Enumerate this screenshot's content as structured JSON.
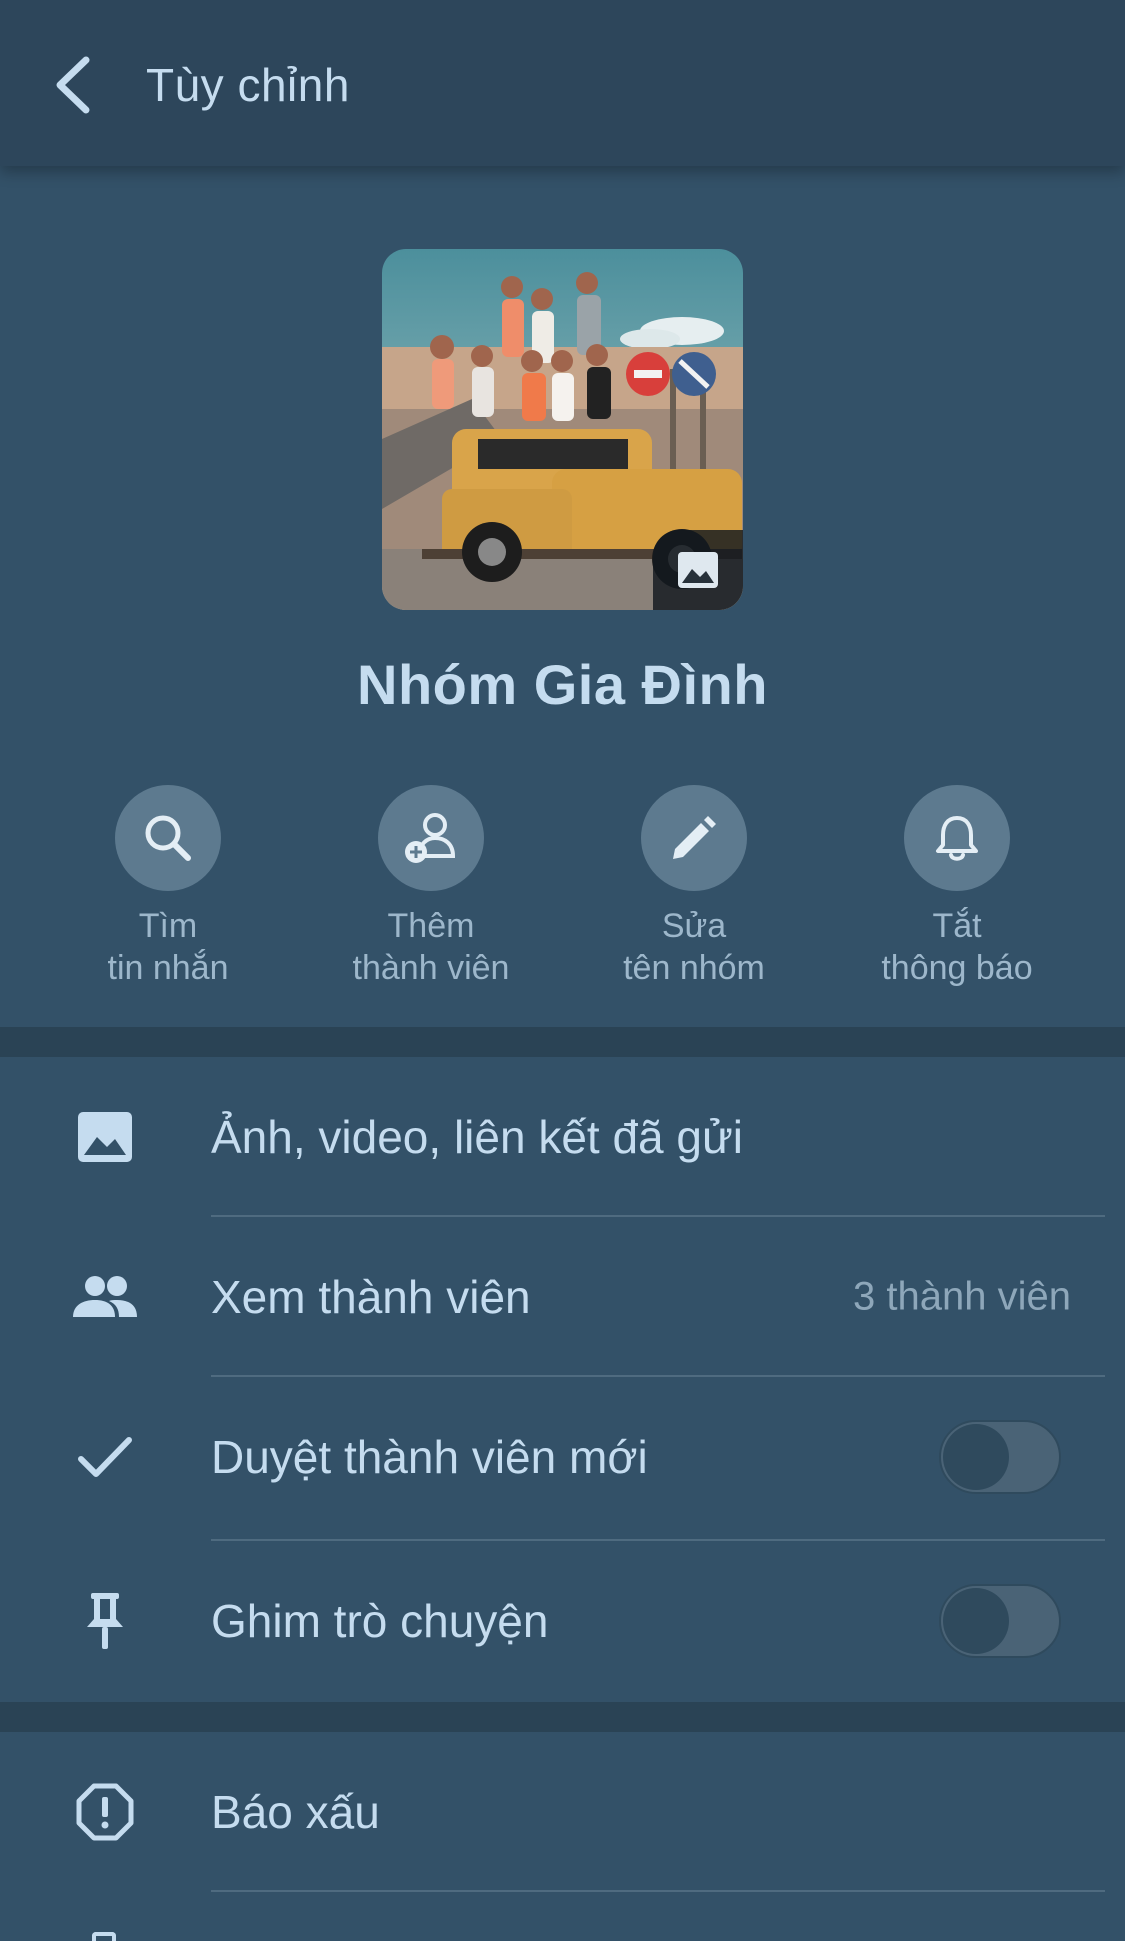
{
  "header": {
    "title": "Tùy chỉnh",
    "back_icon": "chevron-left-icon"
  },
  "group": {
    "name": "Nhóm Gia Đình",
    "avatar_icon": "group-photo",
    "edit_photo_icon": "image-icon"
  },
  "actions": [
    {
      "icon": "search-icon",
      "line1": "Tìm",
      "line2": "tin nhắn"
    },
    {
      "icon": "add-member-icon",
      "line1": "Thêm",
      "line2": "thành viên"
    },
    {
      "icon": "pencil-icon",
      "line1": "Sửa",
      "line2": "tên nhóm"
    },
    {
      "icon": "bell-icon",
      "line1": "Tắt",
      "line2": "thông báo"
    }
  ],
  "menu": {
    "media": {
      "label": "Ảnh, video, liên kết đã gửi",
      "icon": "image-icon"
    },
    "members": {
      "label": "Xem thành viên",
      "value": "3 thành viên",
      "icon": "people-icon"
    },
    "approve": {
      "label": "Duyệt thành viên mới",
      "icon": "check-icon",
      "enabled": false
    },
    "pin": {
      "label": "Ghim trò chuyện",
      "icon": "pin-icon",
      "enabled": false
    },
    "report": {
      "label": "Báo xấu",
      "icon": "alert-icon"
    }
  },
  "colors": {
    "background": "#335168",
    "header": "#2d465b",
    "text": "#c5dcef",
    "muted": "#8ea7ba",
    "action_circle": "#5d7a8f"
  }
}
